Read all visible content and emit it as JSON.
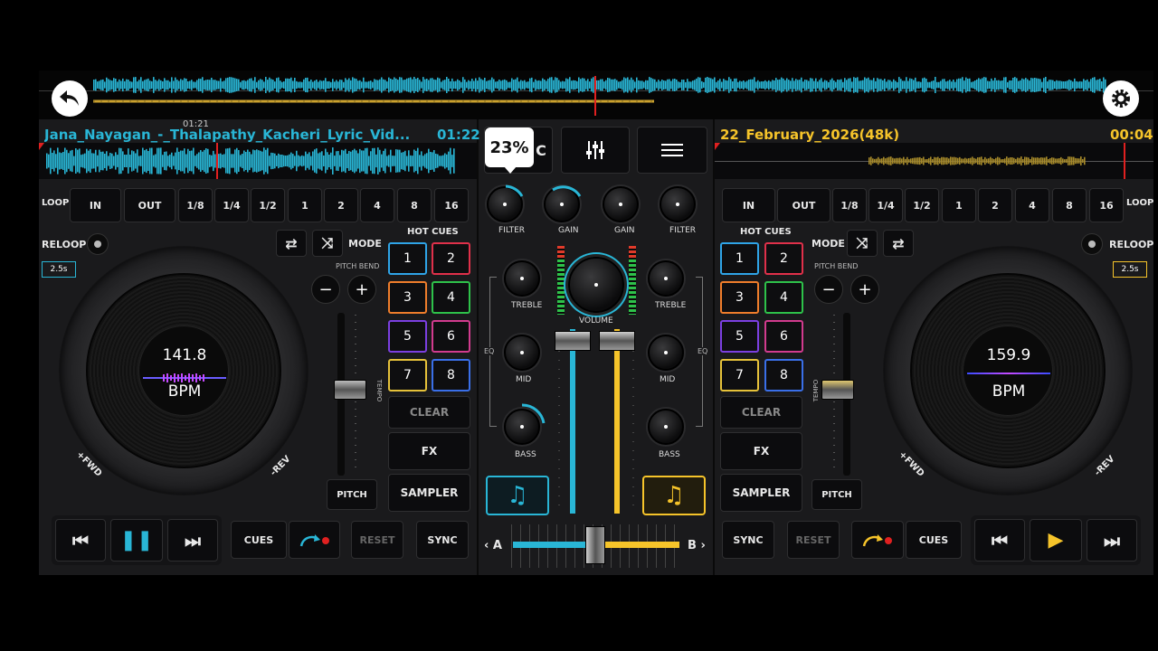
{
  "deck_a": {
    "track_title": "Jana_Nayagan_-_Thalapathy_Kacheri_Lyric_Vid...",
    "time": "01:22",
    "overlay_time": "01:21",
    "bpm_value": "141.8",
    "bpm_label": "BPM",
    "reloop_label": "RELOOP",
    "reloop_time": "2.5s",
    "mode_label": "MODE",
    "pitch_bend_label": "PITCH BEND",
    "tempo_label": "TEMPO",
    "pitch_label": "PITCH",
    "fwd_label": "+FWD",
    "rev_label": "-REV",
    "accent": "#29b6d6"
  },
  "deck_b": {
    "track_title": "22_February_2026(48k)",
    "time": "00:04",
    "bpm_value": "159.9",
    "bpm_label": "BPM",
    "reloop_label": "RELOOP",
    "reloop_time": "2.5s",
    "mode_label": "MODE",
    "pitch_bend_label": "PITCH BEND",
    "tempo_label": "TEMPO",
    "pitch_label": "PITCH",
    "fwd_label": "+FWD",
    "rev_label": "-REV",
    "accent": "#f6c42a"
  },
  "loop": {
    "label": "LOOP",
    "in": "IN",
    "out": "OUT",
    "sizes": [
      "1/8",
      "1/4",
      "1/2",
      "1",
      "2",
      "4",
      "8",
      "16"
    ]
  },
  "hot_cues": {
    "label": "HOT CUES",
    "pads": [
      "1",
      "2",
      "3",
      "4",
      "5",
      "6",
      "7",
      "8"
    ],
    "colors": [
      "#2fa4e7",
      "#e0304a",
      "#ef7d2b",
      "#2ec24a",
      "#7b3fe0",
      "#d23b8e",
      "#e6c23a",
      "#3a6fe8"
    ],
    "clear": "CLEAR",
    "fx": "FX",
    "sampler": "SAMPLER"
  },
  "transport": {
    "cues": "CUES",
    "reset": "RESET",
    "sync": "SYNC"
  },
  "mixer": {
    "zoom_tooltip": "23%",
    "tab_partial": "C",
    "filter": "FILTER",
    "gain": "GAIN",
    "treble": "TREBLE",
    "volume": "VOLUME",
    "eq": "EQ",
    "mid": "MID",
    "bass": "BASS",
    "crossfader_a": "A",
    "crossfader_b": "B"
  },
  "icons": {
    "back": "back-arrow-icon",
    "settings": "gear-icon",
    "mixer": "sliders-icon",
    "menu": "hamburger-menu-icon"
  }
}
